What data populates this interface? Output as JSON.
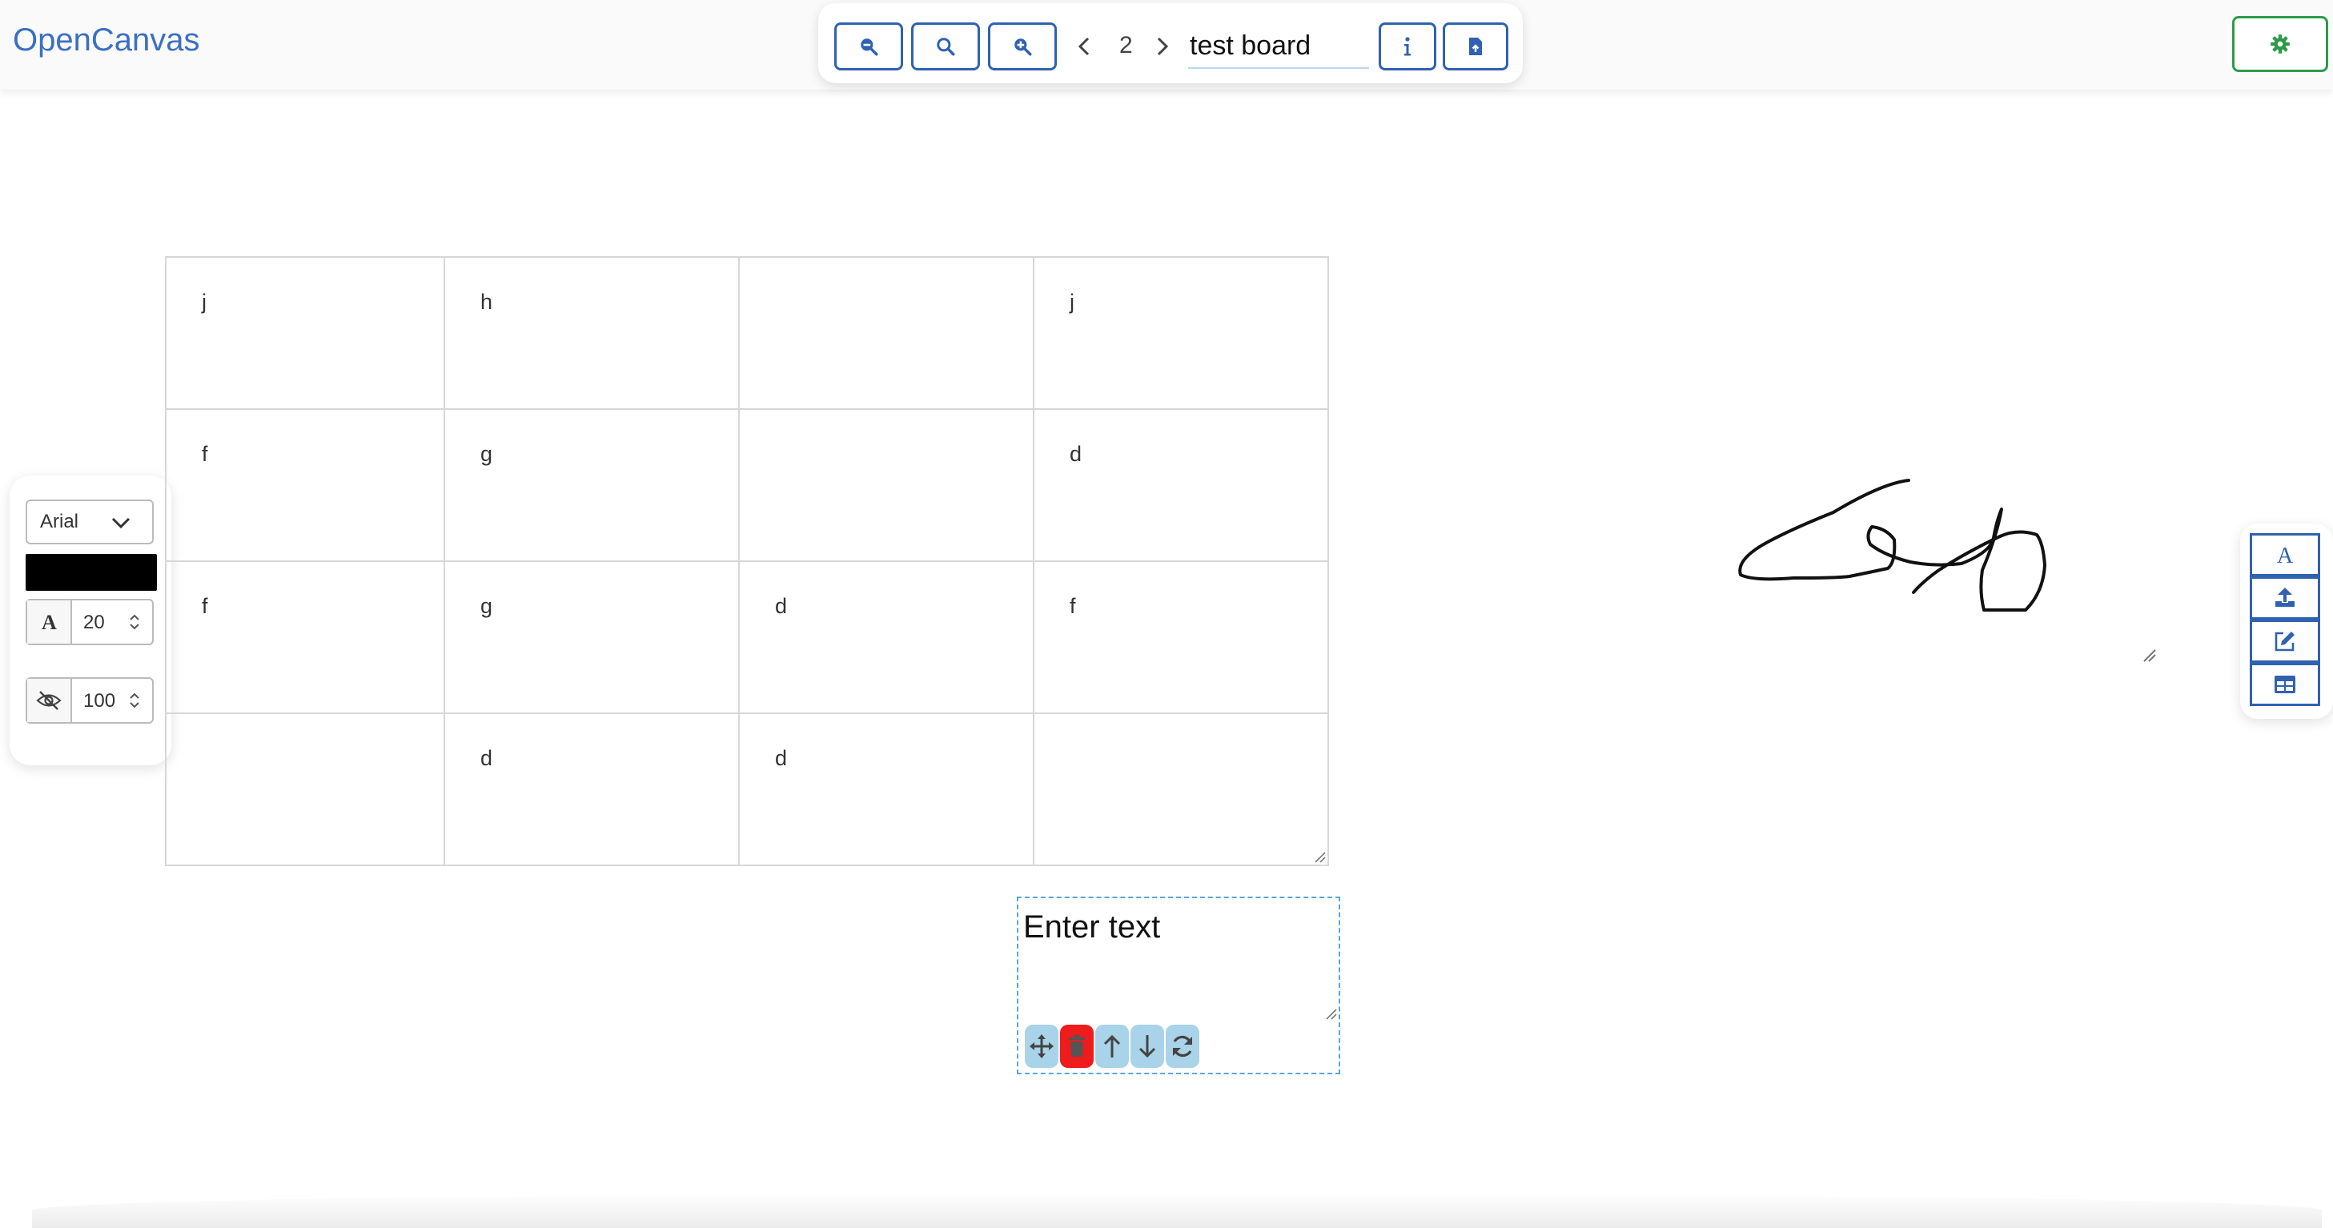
{
  "app": {
    "title": "OpenCanvas"
  },
  "toolbar": {
    "zoom_out_icon": "zoom-out-icon",
    "zoom_reset_icon": "search-icon",
    "zoom_in_icon": "zoom-in-icon",
    "page_number": "2",
    "board_name": "test board",
    "info_icon": "info-icon",
    "export_icon": "file-export-icon"
  },
  "settings": {
    "icon": "gear-icon",
    "accent": "#2e9b4b"
  },
  "properties": {
    "font_family": "Arial",
    "color": "#000000",
    "font_size": "20",
    "opacity": "100"
  },
  "table": {
    "rows": [
      [
        "j",
        "h",
        "",
        "j"
      ],
      [
        "f",
        "g",
        "",
        "d"
      ],
      [
        "f",
        "g",
        "d",
        "f"
      ],
      [
        "",
        "d",
        "d",
        ""
      ]
    ]
  },
  "textbox": {
    "text": "Enter text",
    "tools": [
      "move-icon",
      "trash-icon",
      "arrow-up-icon",
      "arrow-down-icon",
      "rotate-icon"
    ]
  },
  "right_tools": [
    "text-icon",
    "upload-icon",
    "edit-icon",
    "table-icon"
  ],
  "colors": {
    "primary": "#2f62b0",
    "brand": "#3b6fc4",
    "danger": "#ee1c1c",
    "tool_bg": "#a9d3e8"
  }
}
